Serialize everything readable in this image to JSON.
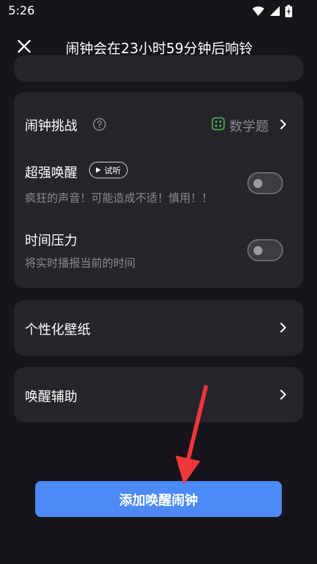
{
  "status": {
    "time": "5:26"
  },
  "header": {
    "title": "闹钟会在23小时59分钟后响铃"
  },
  "challenge": {
    "label": "闹钟挑战",
    "value": "数学题"
  },
  "super_wake": {
    "label": "超强唤醒",
    "try_label": "试听",
    "desc": "疯狂的声音！可能造成不适！慎用！！",
    "enabled": false
  },
  "time_pressure": {
    "label": "时间压力",
    "desc": "将实时播报当前的时间",
    "enabled": false
  },
  "wallpaper": {
    "label": "个性化壁纸"
  },
  "wake_assist": {
    "label": "唤醒辅助"
  },
  "add_button": {
    "label": "添加唤醒闹钟"
  },
  "colors": {
    "accent": "#4d8af5",
    "background": "#17151b",
    "card": "#26252b",
    "annotation_arrow": "#f0353b",
    "icon_green": "#4caf50"
  }
}
